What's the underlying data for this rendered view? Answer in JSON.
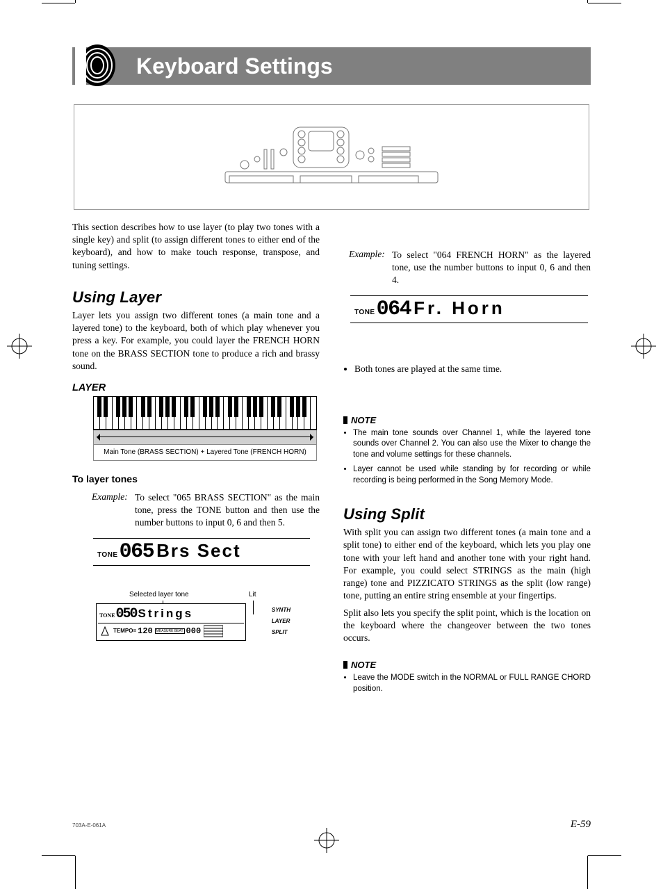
{
  "header": {
    "title": "Keyboard Settings"
  },
  "intro": "This section describes how to use layer (to play two tones with a single key) and split (to assign different tones to either end of the keyboard), and how to make touch response, transpose, and tuning settings.",
  "layer": {
    "heading": "Using Layer",
    "desc": "Layer lets you assign two different tones (a main tone and a layered tone) to the keyboard, both of which play whenever you press a key. For example, you could layer the FRENCH HORN tone on the BRASS SECTION tone to produce a rich and brassy sound.",
    "diagram_label": "LAYER",
    "diagram_caption": "Main Tone (BRASS SECTION) + Layered Tone (FRENCH HORN)",
    "sub_heading": "To layer tones",
    "example_label": "Example:",
    "example_text": "To select \"065 BRASS SECTION\" as the main tone, press the TONE button and then use the number buttons to input 0, 6 and then 5.",
    "tone1_label": "TONE",
    "tone1_digits": "065",
    "tone1_name": "Brs Sect",
    "lcd2": {
      "label_left": "Selected layer tone",
      "label_right": "Lit",
      "tone_label": "TONE",
      "tone_digits": "050",
      "tone_name": "Strings",
      "tempo_label": "TEMPO=",
      "tempo_value": "120",
      "meas_value": "000",
      "meas_label": "MEASURE BEAT",
      "right": [
        "SYNTH",
        "LAYER",
        "SPLIT"
      ]
    }
  },
  "right_col": {
    "example_label": "Example:",
    "example_text": "To select \"064 FRENCH HORN\" as the layered tone, use the number buttons to input 0, 6 and then 4.",
    "tone2_label": "TONE",
    "tone2_digits": "064",
    "tone2_name": "Fr. Horn",
    "bullet1": "Both tones are played at the same time.",
    "note_heading": "NOTE",
    "note_items": [
      "The main tone sounds over Channel 1, while the layered tone sounds over Channel 2. You can also use the Mixer to change the tone and volume settings for these channels.",
      "Layer cannot be used while standing by for recording or while recording is being performed in the Song Memory Mode."
    ]
  },
  "split": {
    "heading": "Using Split",
    "desc1": "With split you can assign two different tones (a main tone and a split tone) to either end of the keyboard, which lets you play one tone with your left hand and another tone with your right hand. For example, you could select STRINGS as the main (high range) tone and PIZZICATO STRINGS as the split (low range) tone, putting an entire string ensemble at your fingertips.",
    "desc2": "Split also lets you specify the split point, which is the location on the keyboard where the changeover between the two tones occurs.",
    "note_heading": "NOTE",
    "note_items": [
      "Leave the MODE switch in the NORMAL or FULL RANGE CHORD position."
    ]
  },
  "footer": {
    "code": "703A-E-061A",
    "page": "E-59"
  }
}
